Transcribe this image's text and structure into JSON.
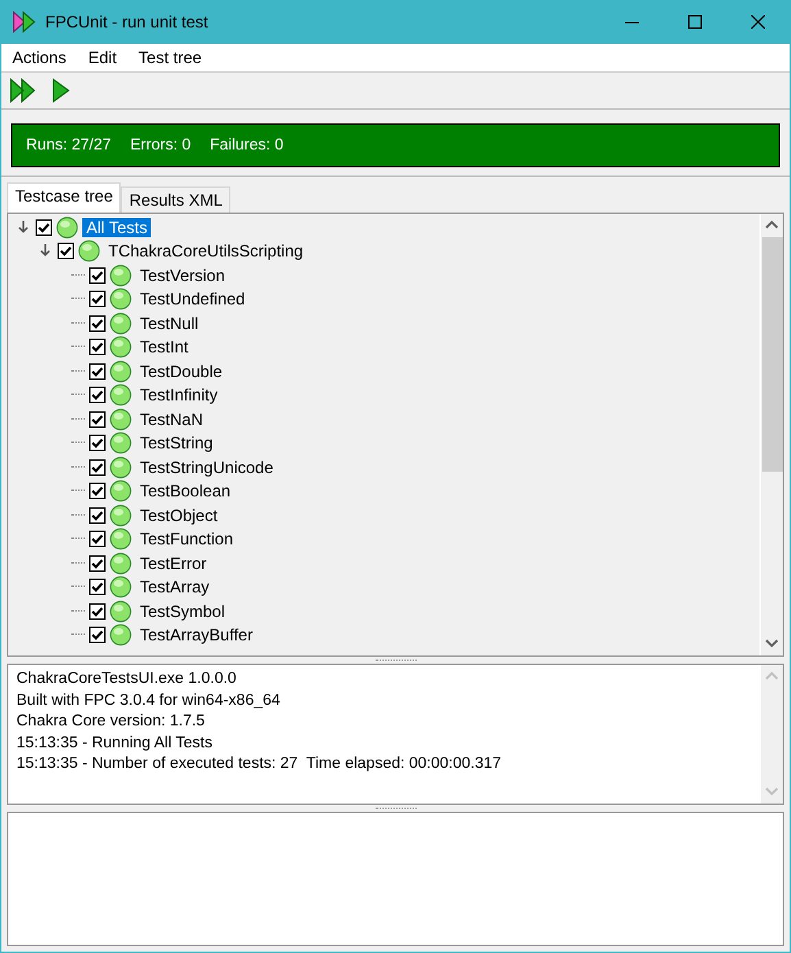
{
  "window": {
    "title": "FPCUnit - run unit test"
  },
  "menu": [
    "Actions",
    "Edit",
    "Test tree"
  ],
  "status": {
    "runs": "Runs: 27/27",
    "errors": "Errors: 0",
    "failures": "Failures: 0",
    "color": "#008000"
  },
  "tabs": [
    {
      "label": "Testcase tree",
      "selected": true
    },
    {
      "label": "Results XML",
      "selected": false
    }
  ],
  "tree": {
    "label": "All Tests",
    "checked": true,
    "selected": true,
    "expanded": true,
    "color": "#8de36a",
    "children": [
      {
        "label": "TChakraCoreUtilsScripting",
        "checked": true,
        "selected": false,
        "expanded": true,
        "color": "#8de36a",
        "children": [
          {
            "label": "TestVersion",
            "checked": true,
            "selected": false,
            "color": "#8de36a"
          },
          {
            "label": "TestUndefined",
            "checked": true,
            "selected": false,
            "color": "#8de36a"
          },
          {
            "label": "TestNull",
            "checked": true,
            "selected": false,
            "color": "#8de36a"
          },
          {
            "label": "TestInt",
            "checked": true,
            "selected": false,
            "color": "#8de36a"
          },
          {
            "label": "TestDouble",
            "checked": true,
            "selected": false,
            "color": "#8de36a"
          },
          {
            "label": "TestInfinity",
            "checked": true,
            "selected": false,
            "color": "#8de36a"
          },
          {
            "label": "TestNaN",
            "checked": true,
            "selected": false,
            "color": "#8de36a"
          },
          {
            "label": "TestString",
            "checked": true,
            "selected": false,
            "color": "#8de36a"
          },
          {
            "label": "TestStringUnicode",
            "checked": true,
            "selected": false,
            "color": "#8de36a"
          },
          {
            "label": "TestBoolean",
            "checked": true,
            "selected": false,
            "color": "#8de36a"
          },
          {
            "label": "TestObject",
            "checked": true,
            "selected": false,
            "color": "#8de36a"
          },
          {
            "label": "TestFunction",
            "checked": true,
            "selected": false,
            "color": "#8de36a"
          },
          {
            "label": "TestError",
            "checked": true,
            "selected": false,
            "color": "#8de36a"
          },
          {
            "label": "TestArray",
            "checked": true,
            "selected": false,
            "color": "#8de36a"
          },
          {
            "label": "TestSymbol",
            "checked": true,
            "selected": false,
            "color": "#8de36a"
          },
          {
            "label": "TestArrayBuffer",
            "checked": true,
            "selected": false,
            "color": "#8de36a"
          }
        ]
      }
    ]
  },
  "log": [
    "ChakraCoreTestsUI.exe 1.0.0.0",
    "Built with FPC 3.0.4 for win64-x86_64",
    "Chakra Core version: 1.7.5",
    "15:13:35 - Running All Tests",
    "15:13:35 - Number of executed tests: 27  Time elapsed: 00:00:00.317"
  ]
}
